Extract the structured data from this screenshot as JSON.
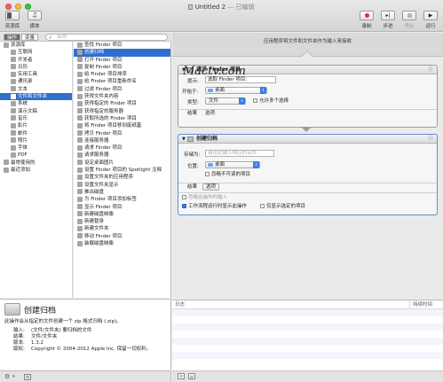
{
  "window": {
    "title": "Untitled 2",
    "subtitle": "— 已编辑",
    "light_colors": [
      "#fc5f57",
      "#fdbc2e",
      "#33c748"
    ]
  },
  "toolbar": {
    "library_label": "资源库",
    "media_label": "媒体",
    "record_label": "录制",
    "step_label": "步进",
    "stop_label": "停止",
    "run_label": "运行",
    "record_color": "#e0312b"
  },
  "left_header": {
    "actions_tab": "操作",
    "variables_tab": "变量",
    "search_placeholder": "名称"
  },
  "library": [
    {
      "label": "资源库",
      "indent": false,
      "icon": "library-icon",
      "selected": false
    },
    {
      "label": "互联网",
      "indent": true,
      "icon": "internet-icon",
      "selected": false
    },
    {
      "label": "开发者",
      "indent": true,
      "icon": "developer-icon",
      "selected": false
    },
    {
      "label": "日历",
      "indent": true,
      "icon": "calendar-icon",
      "selected": false
    },
    {
      "label": "实用工具",
      "indent": true,
      "icon": "utilities-icon",
      "selected": false
    },
    {
      "label": "通讯录",
      "indent": true,
      "icon": "contacts-icon",
      "selected": false
    },
    {
      "label": "文本",
      "indent": true,
      "icon": "text-icon",
      "selected": false
    },
    {
      "label": "文件和文件夹",
      "indent": true,
      "icon": "files-folders-icon",
      "selected": true
    },
    {
      "label": "系统",
      "indent": true,
      "icon": "system-icon",
      "selected": false
    },
    {
      "label": "演示文稿",
      "indent": true,
      "icon": "presentations-icon",
      "selected": false
    },
    {
      "label": "音乐",
      "indent": true,
      "icon": "music-icon",
      "selected": false
    },
    {
      "label": "影片",
      "indent": true,
      "icon": "movies-icon",
      "selected": false
    },
    {
      "label": "邮件",
      "indent": true,
      "icon": "mail-icon",
      "selected": false
    },
    {
      "label": "照片",
      "indent": true,
      "icon": "photos-icon",
      "selected": false
    },
    {
      "label": "字体",
      "indent": true,
      "icon": "fonts-icon",
      "selected": false
    },
    {
      "label": "PDF",
      "indent": true,
      "icon": "pdf-icon",
      "selected": false
    },
    {
      "label": "最常使用的",
      "indent": false,
      "icon": "most-used-icon",
      "selected": false
    },
    {
      "label": "最近添加",
      "indent": false,
      "icon": "recently-added-icon",
      "selected": false
    }
  ],
  "actions": [
    "查找 Finder 项目",
    "创建归档",
    "打开 Finder 项目",
    "复制 Finder 项目",
    "给 Finder 项目排序",
    "给 Finder 项目重新命名",
    "过滤 Finder 项目",
    "获得文件夹内容",
    "获得指定的 Finder 项目",
    "获得指定的服务器",
    "获取所选的 Finder 项目",
    "将 Finder 项目移到废纸篓",
    "拷贝 Finder 项目",
    "连接服务器",
    "请求 Finder 项目",
    "请求服务器",
    "设定桌面图片",
    "设置 Finder 项目的 Spotlight 注释",
    "设置文件夹的应用程序",
    "设置文件夹显示",
    "推出磁盘",
    "为 Finder 项目添加标签",
    "显示 Finder 项目",
    "新建磁盘映像",
    "新建替身",
    "新建文件夹",
    "移动 Finder 项目",
    "装载磁盘映像"
  ],
  "selected_action_index": 1,
  "description": {
    "title": "创建归档",
    "text": "此操作会从指定的文件创建一个 zip 格式归档 (.zip)。",
    "rows": [
      {
        "k": "输入:",
        "v": "(文件/文件夹) 要归档的文件"
      },
      {
        "k": "结果:",
        "v": "文件/文件夹"
      },
      {
        "k": "版本:",
        "v": "1.3.2"
      },
      {
        "k": "版权:",
        "v": "Copyright © 2004-2012 Apple Inc. 保留一切权利。"
      }
    ]
  },
  "workflow": {
    "receive_text": "应用程序将文件和文件夹作为输入来接收",
    "watermark": "Mactv.com",
    "action1": {
      "title": "请求 Finder 项目",
      "prompt_label": "提示:",
      "prompt_value": "选取 Finder 项目:",
      "start_label": "开始于:",
      "start_value": "桌面",
      "type_label": "类型:",
      "type_value": "文件",
      "multi_label": "允许多个选择",
      "results_label": "结果",
      "options_label": "选项"
    },
    "action2": {
      "title": "创建归档",
      "save_as_label": "存储为:",
      "save_as_placeholder": "请在此输入相应的名称",
      "where_label": "位置:",
      "where_value": "桌面",
      "ignore_label": "忽略不可读的项目",
      "results_label": "结果",
      "options_label": "选项",
      "ignore_input_label": "忽略此操作的输入",
      "show_when_run_label": "工作流程运行时显示此操作",
      "show_selected_label": "仅显示选定的项目"
    }
  },
  "log": {
    "col_log": "日志",
    "col_duration": "持续时间"
  }
}
